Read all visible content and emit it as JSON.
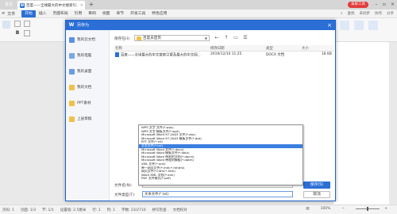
{
  "tabs": {
    "home": "首页",
    "doc_title": "百度——全球最大的中文搜索引...",
    "screen_record": "录屏工具"
  },
  "menu": {
    "file": "文件",
    "items": [
      "开始",
      "插入",
      "页面布局",
      "引用",
      "审阅",
      "视图",
      "章节",
      "开发工具",
      "特色应用"
    ],
    "active": "开始",
    "search": "查找",
    "right": [
      "未同步",
      "协作",
      "分享"
    ]
  },
  "dialog": {
    "title": "另存为",
    "sidebar": [
      "我的云文档",
      "我的电脑",
      "我的桌面",
      "我的文档",
      "PPT素材",
      "上层草稿"
    ],
    "location_label": "保存在(I):",
    "location_value": "百度去首页",
    "columns": {
      "name": "名称",
      "modified": "修改日期",
      "type": "类型",
      "size": "大小"
    },
    "files": [
      {
        "name": "百度——全球最大的中文搜索引擎及最大的中文网...",
        "modified": "2019/12/10 11:25",
        "type": "DOCX 文档",
        "size": "18 KB"
      }
    ],
    "filename_label": "文件名(N):",
    "filetype_label": "文件类型(T):",
    "filetype_value": "文本文件(*.txt)",
    "save_label": "保存(S)",
    "cancel_label": "取消"
  },
  "format_options": [
    "WPS 文字 文件(*.wps)",
    "WPS 文字 模板文件(*.wpt)",
    "Microsoft Word 97-2003 文件(*.doc)",
    "Microsoft Word 97-2003 模板文件(*.dot)",
    "RTF 文件(*.rtf)",
    "文本文件(*.txt)",
    "Microsoft Word 文件(*.docx)",
    "Microsoft Word 模板文件(*.dotx)",
    "Microsoft Word 带宏的文档(*.docm)",
    "Microsoft Word 带宏的模板(*.dotm)",
    "XML 文件(*.xml)",
    "单一网页文件(*.mht;*.mhtml)",
    "网页文件(*.html;*.htm)",
    "Word XML 文档(*.xml)",
    "PDF 文件格式(*.pdf)"
  ],
  "selected_format_index": 5,
  "status": {
    "page": "页码: 1",
    "pages": "页面: 1/3",
    "section": "节: 1/1",
    "setting": "设置值: 2.5厘米",
    "row": "行: 1",
    "col": "列: 1",
    "words": "字数: 23/2710",
    "spell": "拼写检查",
    "proof": "文档校对",
    "zoom": "100%"
  },
  "colors": {
    "accent": "#2b6fd6",
    "record": "#e23c3c"
  }
}
